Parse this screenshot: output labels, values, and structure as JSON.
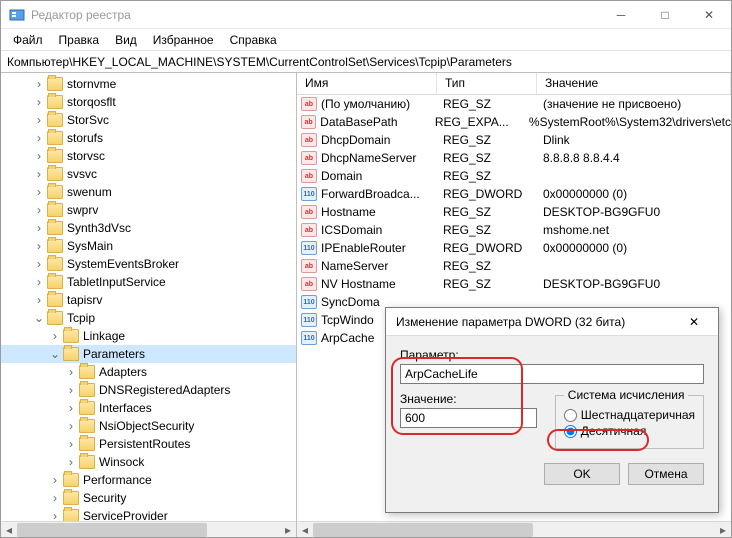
{
  "window": {
    "title": "Редактор реестра"
  },
  "menu": [
    "Файл",
    "Правка",
    "Вид",
    "Избранное",
    "Справка"
  ],
  "address": "Компьютер\\HKEY_LOCAL_MACHINE\\SYSTEM\\CurrentControlSet\\Services\\Tcpip\\Parameters",
  "tree": [
    {
      "d": 2,
      "t": "",
      "n": "stornvme"
    },
    {
      "d": 2,
      "t": "",
      "n": "storqosflt"
    },
    {
      "d": 2,
      "t": "",
      "n": "StorSvc"
    },
    {
      "d": 2,
      "t": "",
      "n": "storufs"
    },
    {
      "d": 2,
      "t": "",
      "n": "storvsc"
    },
    {
      "d": 2,
      "t": "",
      "n": "svsvc"
    },
    {
      "d": 2,
      "t": "",
      "n": "swenum"
    },
    {
      "d": 2,
      "t": "",
      "n": "swprv"
    },
    {
      "d": 2,
      "t": "",
      "n": "Synth3dVsc"
    },
    {
      "d": 2,
      "t": "",
      "n": "SysMain"
    },
    {
      "d": 2,
      "t": "",
      "n": "SystemEventsBroker"
    },
    {
      "d": 2,
      "t": "",
      "n": "TabletInputService"
    },
    {
      "d": 2,
      "t": "",
      "n": "tapisrv"
    },
    {
      "d": 2,
      "t": "v",
      "n": "Tcpip"
    },
    {
      "d": 3,
      "t": "",
      "n": "Linkage"
    },
    {
      "d": 3,
      "t": "v",
      "n": "Parameters",
      "sel": true
    },
    {
      "d": 4,
      "t": "",
      "n": "Adapters"
    },
    {
      "d": 4,
      "t": "",
      "n": "DNSRegisteredAdapters"
    },
    {
      "d": 4,
      "t": "",
      "n": "Interfaces"
    },
    {
      "d": 4,
      "t": "",
      "n": "NsiObjectSecurity"
    },
    {
      "d": 4,
      "t": "",
      "n": "PersistentRoutes"
    },
    {
      "d": 4,
      "t": "",
      "n": "Winsock"
    },
    {
      "d": 3,
      "t": "",
      "n": "Performance"
    },
    {
      "d": 3,
      "t": "",
      "n": "Security"
    },
    {
      "d": 3,
      "t": "",
      "n": "ServiceProvider"
    }
  ],
  "columns": {
    "name": "Имя",
    "type": "Тип",
    "value": "Значение"
  },
  "rows": [
    {
      "icon": "sz",
      "n": "(По умолчанию)",
      "t": "REG_SZ",
      "v": "(значение не присвоено)"
    },
    {
      "icon": "sz",
      "n": "DataBasePath",
      "t": "REG_EXPA...",
      "v": "%SystemRoot%\\System32\\drivers\\etc"
    },
    {
      "icon": "sz",
      "n": "DhcpDomain",
      "t": "REG_SZ",
      "v": "Dlink"
    },
    {
      "icon": "sz",
      "n": "DhcpNameServer",
      "t": "REG_SZ",
      "v": "8.8.8.8 8.8.4.4"
    },
    {
      "icon": "sz",
      "n": "Domain",
      "t": "REG_SZ",
      "v": ""
    },
    {
      "icon": "dw",
      "n": "ForwardBroadca...",
      "t": "REG_DWORD",
      "v": "0x00000000 (0)"
    },
    {
      "icon": "sz",
      "n": "Hostname",
      "t": "REG_SZ",
      "v": "DESKTOP-BG9GFU0"
    },
    {
      "icon": "sz",
      "n": "ICSDomain",
      "t": "REG_SZ",
      "v": "mshome.net"
    },
    {
      "icon": "dw",
      "n": "IPEnableRouter",
      "t": "REG_DWORD",
      "v": "0x00000000 (0)"
    },
    {
      "icon": "sz",
      "n": "NameServer",
      "t": "REG_SZ",
      "v": ""
    },
    {
      "icon": "sz",
      "n": "NV Hostname",
      "t": "REG_SZ",
      "v": "DESKTOP-BG9GFU0"
    },
    {
      "icon": "dw",
      "n": "SyncDoma",
      "t": "",
      "v": ""
    },
    {
      "icon": "dw",
      "n": "TcpWindo",
      "t": "",
      "v": ""
    },
    {
      "icon": "dw",
      "n": "ArpCache",
      "t": "",
      "v": ""
    }
  ],
  "dialog": {
    "title": "Изменение параметра DWORD (32 бита)",
    "param_label": "Параметр:",
    "param_value": "ArpCacheLife",
    "value_label": "Значение:",
    "value_value": "600",
    "base_legend": "Система исчисления",
    "hex": "Шестнадцатеричная",
    "dec": "Десятичная",
    "ok": "OK",
    "cancel": "Отмена"
  },
  "glyph": {
    "ab": "ab",
    "dw": "110"
  }
}
